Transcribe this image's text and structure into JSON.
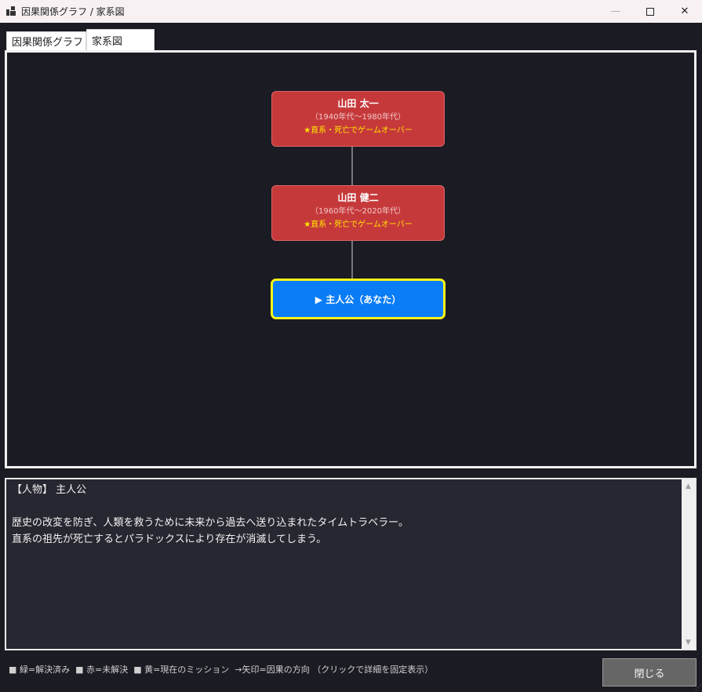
{
  "window": {
    "title": "因果関係グラフ / 家系図",
    "minimize": "—",
    "close": "✕"
  },
  "tabs": [
    {
      "label": "因果関係グラフ",
      "active": false
    },
    {
      "label": "家系図",
      "active": true
    }
  ],
  "family_tree": {
    "nodes": [
      {
        "name": "山田 太一",
        "years": "（1940年代～1980年代）",
        "note": "★直系・死亡でゲームオーバー"
      },
      {
        "name": "山田 健二",
        "years": "（1960年代～2020年代）",
        "note": "★直系・死亡でゲームオーバー"
      }
    ],
    "player": {
      "label": "▶ 主人公（あなた）"
    }
  },
  "description": {
    "heading": "【人物】 主人公",
    "line1": "歴史の改変を防ぎ、人類を救うために未来から過去へ送り込まれたタイムトラベラー。",
    "line2": "直系の祖先が死亡するとパラドックスにより存在が消滅してしまう。"
  },
  "scrollbar": {
    "up": "▲",
    "down": "▼"
  },
  "legend": "■ 緑=解決済み  ■ 赤=未解決  ■ 黄=現在のミッション  →矢印=因果の方向 （クリックで詳細を固定表示）",
  "close_button": "閉じる",
  "colors": {
    "unresolved": "#c6393b",
    "player": "#0a7cf6",
    "player_border": "#f6f31a",
    "warning": "#ffe600"
  }
}
